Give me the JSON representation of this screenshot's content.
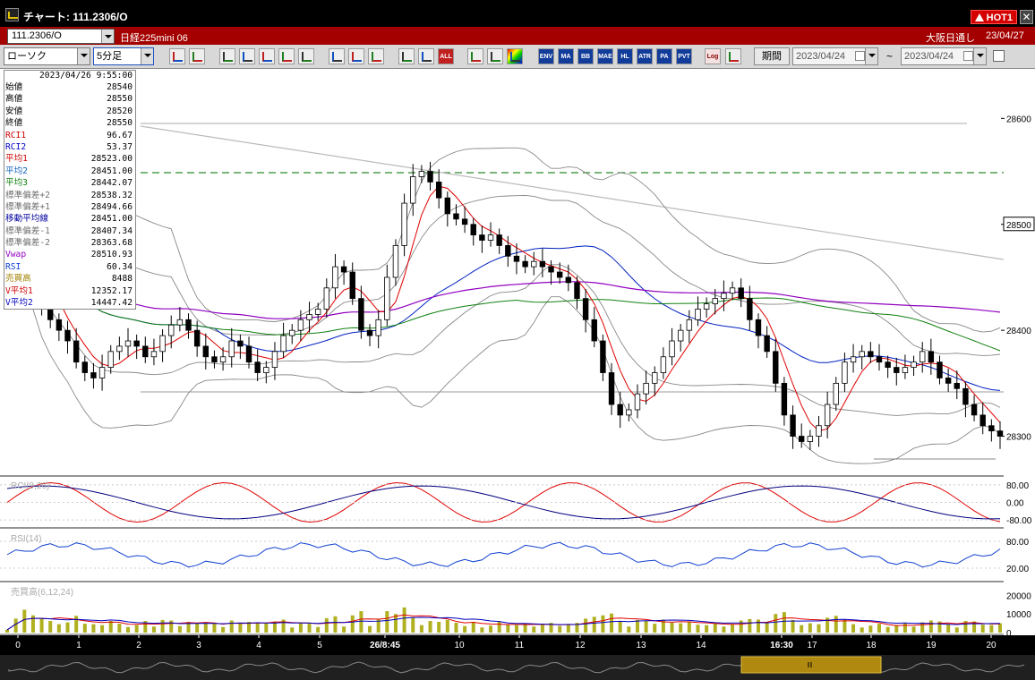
{
  "window": {
    "title": "チャート: 111.2306/O",
    "hot_badge": "HOT1",
    "close_label": "✕"
  },
  "header": {
    "symbol": "111.2306/O",
    "instrument_name": "日経225mini 06",
    "session": "大阪日通し",
    "date": "23/04/27"
  },
  "toolbar": {
    "chart_type": "ローソク",
    "interval": "5分足",
    "buttons": [
      "zoom-icon",
      "cursor-icon",
      "draw-line-icon",
      "zoom-area-icon",
      "grid-icon",
      "compare-icon",
      "lock-icon",
      "pencil-icon",
      "arrow-tool-icon",
      "undo-icon",
      "candle-mode-icon",
      "bar-mode-icon",
      "ALL",
      "settings-icon",
      "tools-icon",
      "color-icon",
      "ENV",
      "MA",
      "BB",
      "MAE",
      "HL",
      "ATR",
      "PA",
      "PVT",
      "Log",
      "export-icon"
    ],
    "period_label": "期間",
    "date_from": "2023/04/24",
    "tilde": "~",
    "date_to": "2023/04/24"
  },
  "datawindow": {
    "datetime": "2023/04/26 9:55:00",
    "rows": [
      {
        "label": "始値",
        "value": "28540",
        "color": "#000000"
      },
      {
        "label": "高値",
        "value": "28550",
        "color": "#000000"
      },
      {
        "label": "安値",
        "value": "28520",
        "color": "#000000"
      },
      {
        "label": "終値",
        "value": "28550",
        "color": "#000000"
      },
      {
        "label": "RCI1",
        "value": "96.67",
        "color": "#d00000"
      },
      {
        "label": "RCI2",
        "value": "53.37",
        "color": "#0000c0"
      },
      {
        "label": "平均1",
        "value": "28523.00",
        "color": "#d00000"
      },
      {
        "label": "平均2",
        "value": "28451.00",
        "color": "#1060c0"
      },
      {
        "label": "平均3",
        "value": "28442.07",
        "color": "#108010"
      },
      {
        "label": "標準偏差+2",
        "value": "28538.32",
        "color": "#707070"
      },
      {
        "label": "標準偏差+1",
        "value": "28494.66",
        "color": "#707070"
      },
      {
        "label": "移動平均線",
        "value": "28451.00",
        "color": "#0000a0"
      },
      {
        "label": "標準偏差-1",
        "value": "28407.34",
        "color": "#707070"
      },
      {
        "label": "標準偏差-2",
        "value": "28363.68",
        "color": "#707070"
      },
      {
        "label": "Vwap",
        "value": "28510.93",
        "color": "#9000c0"
      },
      {
        "label": "RSI",
        "value": "60.34",
        "color": "#1040d0"
      },
      {
        "label": "売買高",
        "value": "8488",
        "color": "#a08000"
      },
      {
        "label": "V平均1",
        "value": "12352.17",
        "color": "#d00000"
      },
      {
        "label": "V平均2",
        "value": "14447.42",
        "color": "#0000c0"
      }
    ]
  },
  "chart_data": {
    "type": "candlestick",
    "price_axis": {
      "ticks": [
        "28600",
        "28500",
        "28400",
        "28300"
      ],
      "current_price": "28500",
      "range": [
        28265,
        28640
      ]
    },
    "rci_panel": {
      "label": "RCI(9,26)",
      "ticks": [
        "80.00",
        "0.00",
        "-80.00"
      ]
    },
    "rsi_panel": {
      "label": "RSI(14)",
      "ticks": [
        "80.00",
        "20.00"
      ]
    },
    "volume_panel": {
      "label": "売買高(6,12,24)",
      "ticks": [
        "20000",
        "10000",
        "0"
      ],
      "max": 25000
    },
    "x_ticks": [
      "0",
      "1",
      "2",
      "3",
      "4",
      "5",
      "26/8:45",
      "10",
      "11",
      "12",
      "13",
      "14",
      "16:30",
      "17",
      "18",
      "19",
      "20"
    ],
    "colors": {
      "up": "#ffffff",
      "down": "#000000",
      "ma1": "#e00000",
      "ma2": "#0020c0",
      "ma3": "#108010",
      "vwap": "#9000c0",
      "bb": "#888888",
      "volume": "#b0b020"
    },
    "closes": [
      28525,
      28505,
      28470,
      28440,
      28420,
      28410,
      28400,
      28390,
      28370,
      28360,
      28355,
      28365,
      28380,
      28385,
      28390,
      28385,
      28375,
      28380,
      28395,
      28405,
      28410,
      28400,
      28385,
      28375,
      28370,
      28375,
      28390,
      28385,
      28370,
      28360,
      28365,
      28380,
      28395,
      28400,
      28410,
      28415,
      28420,
      28440,
      28460,
      28455,
      28430,
      28400,
      28395,
      28410,
      28450,
      28480,
      28520,
      28545,
      28550,
      28540,
      28525,
      28510,
      28505,
      28500,
      28490,
      28485,
      28490,
      28480,
      28470,
      28465,
      28460,
      28465,
      28460,
      28455,
      28450,
      28445,
      28430,
      28410,
      28390,
      28360,
      28330,
      28320,
      28325,
      28340,
      28350,
      28360,
      28375,
      28390,
      28400,
      28410,
      28420,
      28425,
      28430,
      28435,
      28440,
      28430,
      28410,
      28395,
      28380,
      28350,
      28320,
      28300,
      28295,
      28300,
      28310,
      28330,
      28350,
      28370,
      28375,
      28380,
      28375,
      28370,
      28365,
      28360,
      28365,
      28370,
      28380,
      28370,
      28355,
      28350,
      28345,
      28330,
      28320,
      28310,
      28305,
      28300
    ]
  }
}
